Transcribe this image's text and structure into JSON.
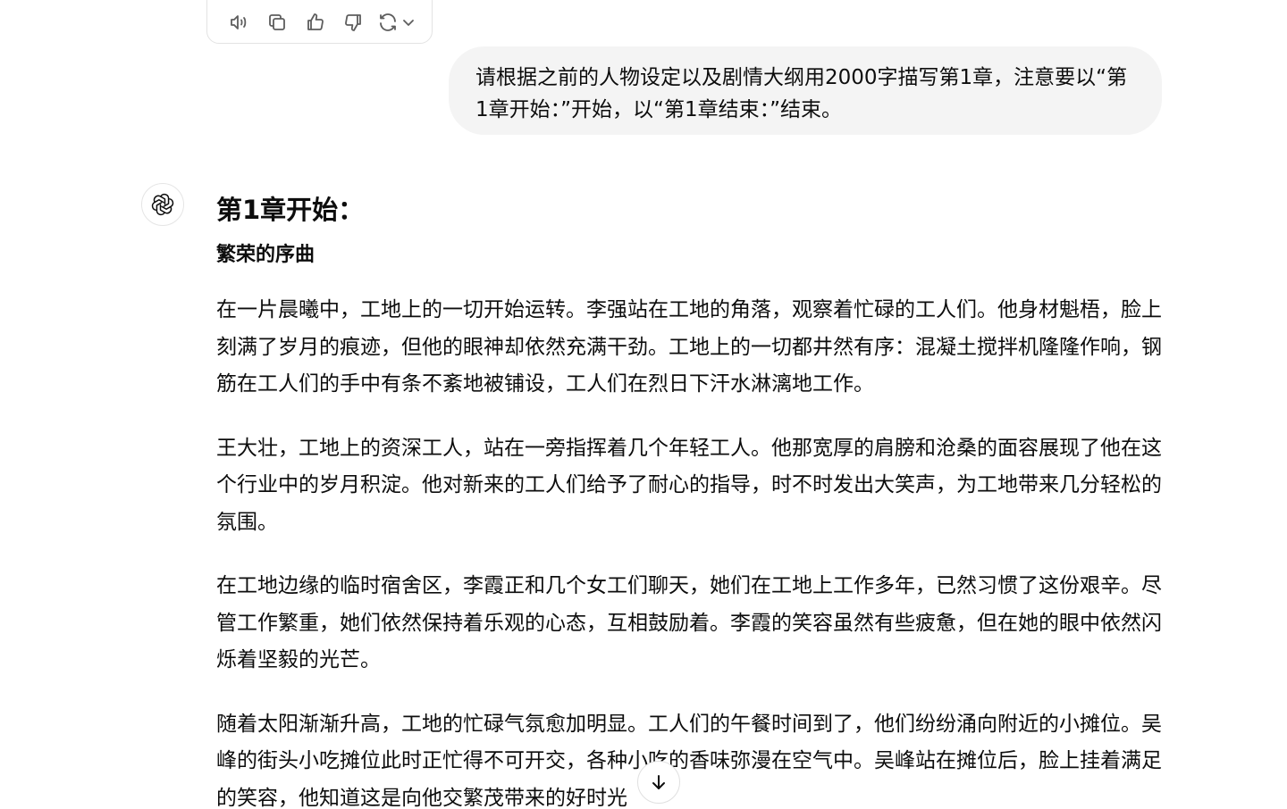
{
  "action_bar": {
    "icons": [
      "speaker-icon",
      "copy-icon",
      "thumbs-up-icon",
      "thumbs-down-icon",
      "regenerate-icon",
      "chevron-down-icon"
    ]
  },
  "user_message": {
    "text": "请根据之前的人物设定以及剧情大纲用2000字描写第1章，注意要以“第1章开始：”开始，以“第1章结束：”结束。"
  },
  "assistant_message": {
    "chapter_title": "第1章开始：",
    "section_title": "繁荣的序曲",
    "paragraphs": [
      "在一片晨曦中，工地上的一切开始运转。李强站在工地的角落，观察着忙碌的工人们。他身材魁梧，脸上刻满了岁月的痕迹，但他的眼神却依然充满干劲。工地上的一切都井然有序：混凝土搅拌机隆隆作响，钢筋在工人们的手中有条不紊地被铺设，工人们在烈日下汗水淋漓地工作。",
      "王大壮，工地上的资深工人，站在一旁指挥着几个年轻工人。他那宽厚的肩膀和沧桑的面容展现了他在这个行业中的岁月积淀。他对新来的工人们给予了耐心的指导，时不时发出大笑声，为工地带来几分轻松的氛围。",
      "在工地边缘的临时宿舍区，李霞正和几个女工们聊天，她们在工地上工作多年，已然习惯了这份艰辛。尽管工作繁重，她们依然保持着乐观的心态，互相鼓励着。李霞的笑容虽然有些疲惫，但在她的眼中依然闪烁着坚毅的光芒。",
      "随着太阳渐渐升高，工地的忙碌气氛愈加明显。工人们的午餐时间到了，他们纷纷涌向附近的小摊位。吴峰的街头小吃摊位此时正忙得不可开交，各种小吃的香味弥漫在空气中。吴峰站在摊位后，脸上挂着满足的笑容，他知道这是向他交繁茂带来的好时光"
    ]
  },
  "scroll_button": {
    "icon": "arrow-down-icon"
  }
}
